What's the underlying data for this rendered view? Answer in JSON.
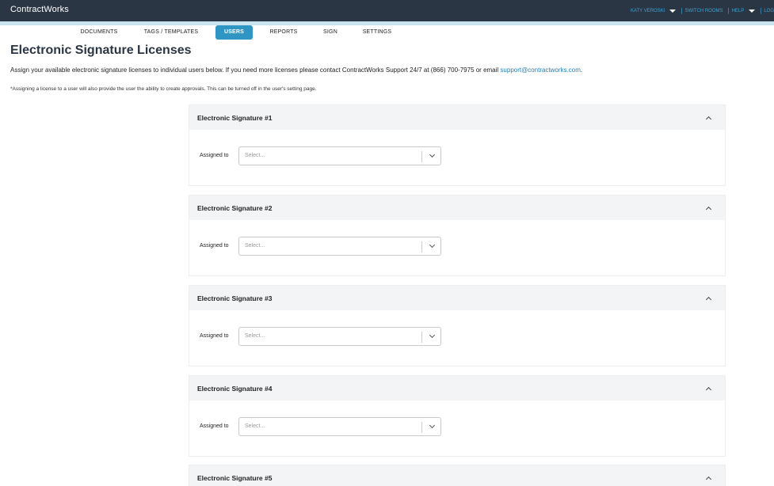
{
  "app": {
    "brand": "ContractWorks"
  },
  "user_menu": {
    "user": "KATY VEROSKI",
    "switch_rooms": "SWITCH ROOMS",
    "help": "HELP",
    "logout": "LOG"
  },
  "nav": {
    "tabs": [
      {
        "label": "DOCUMENTS"
      },
      {
        "label": "TAGS / TEMPLATES"
      },
      {
        "label": "USERS"
      },
      {
        "label": "REPORTS"
      },
      {
        "label": "SIGN"
      },
      {
        "label": "SETTINGS"
      }
    ]
  },
  "page": {
    "title": "Electronic Signature Licenses",
    "description": "Assign your available electronic signature licenses to individual users below. If you need more licenses please contact ContractWorks Support 24/7 at (866) 700-7975 or email ",
    "support_email": "support@contractworks.com",
    "description_end": ".",
    "note": "*Assigning a license to a user will also provide the user the ability to create approvals. This can be turned off in the user's setting page."
  },
  "licenses": [
    {
      "title": "Electronic Signature #1",
      "assigned_label": "Assigned to",
      "placeholder": "Select..."
    },
    {
      "title": "Electronic Signature #2",
      "assigned_label": "Assigned to",
      "placeholder": "Select..."
    },
    {
      "title": "Electronic Signature #3",
      "assigned_label": "Assigned to",
      "placeholder": "Select..."
    },
    {
      "title": "Electronic Signature #4",
      "assigned_label": "Assigned to",
      "placeholder": "Select..."
    },
    {
      "title": "Electronic Signature #5",
      "assigned_label": "Assigned to",
      "placeholder": "Select..."
    }
  ],
  "colors": {
    "topbar": "#2b3644",
    "accent": "#2f96c3",
    "link": "#1f7fb8"
  },
  "icons": {
    "menu_caret": "caret-down-icon",
    "collapse": "chevron-up-icon",
    "select_arrow": "chevron-down-icon"
  }
}
